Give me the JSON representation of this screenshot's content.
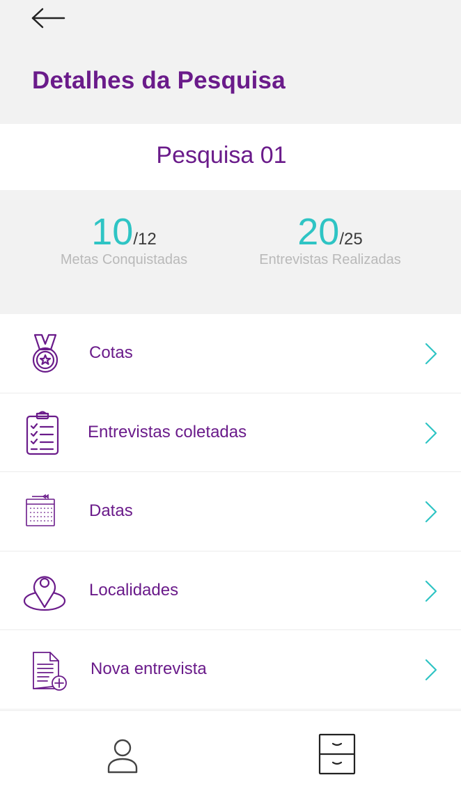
{
  "header": {
    "back_icon": "arrow-left-icon",
    "title": "Detalhes da Pesquisa"
  },
  "survey": {
    "name": "Pesquisa 01"
  },
  "stats": [
    {
      "value": "10",
      "total": "/12",
      "label": "Metas Conquistadas"
    },
    {
      "value": "20",
      "total": "/25",
      "label": "Entrevistas Realizadas"
    }
  ],
  "menu": {
    "items": [
      {
        "label": "Cotas",
        "icon": "medal-icon"
      },
      {
        "label": "Entrevistas coletadas",
        "icon": "clipboard-checklist-icon"
      },
      {
        "label": "Datas",
        "icon": "calendar-icon"
      },
      {
        "label": "Localidades",
        "icon": "location-pin-icon"
      },
      {
        "label": "Nova entrevista",
        "icon": "new-document-icon"
      }
    ],
    "chevron_icon": "chevron-right-icon"
  },
  "bottom_nav": {
    "items": [
      {
        "icon": "user-profile-icon"
      },
      {
        "icon": "archive-drawer-icon"
      }
    ]
  },
  "colors": {
    "primary": "#6a1b8a",
    "accent": "#2ec4c4",
    "muted": "#b9b9b9",
    "background_gray": "#f2f2f2"
  }
}
